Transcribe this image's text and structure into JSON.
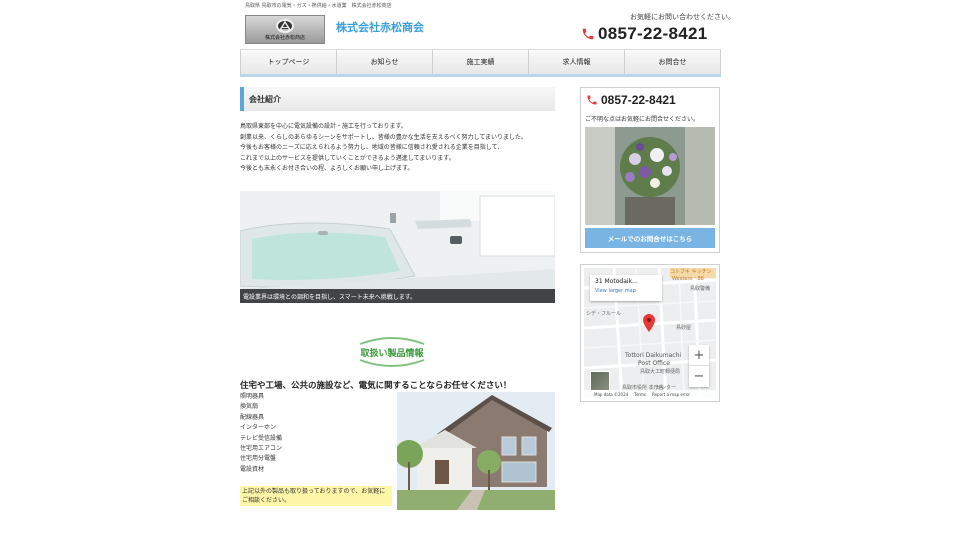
{
  "header": {
    "tagline": "鳥取県 鳥取市の電気・ガス・熱供給・水道業　株式会社赤松商店",
    "logo_text": "株式会社赤松商店",
    "company_name": "株式会社赤松商会",
    "contact_note": "お気軽にお問い合わせください。",
    "phone": "0857-22-8421"
  },
  "nav": {
    "items": [
      "トップページ",
      "お知らせ",
      "施工実績",
      "求人情報",
      "お問合せ"
    ]
  },
  "main": {
    "section_title": "会社紹介",
    "intro_lines": [
      "鳥取県東部を中心に電気設備の設計・施工を行っております。",
      "創業以来、くらしのあらゆるシーンをサポートし、皆様の豊かな生活を支えるべく努力してまいりました。",
      "今後もお客様のニーズに応えられるよう努力し、地域の皆様に信頼され愛される企業を目指して、",
      "これまで以上のサービスを提供していくことができるよう邁進してまいります。",
      "今後とも末永くお付き合いの程、よろしくお願い申し上げます。"
    ],
    "bath_caption": "電設業界は環境との調和を目指し、スマート未来へ挑戦します。",
    "products_badge": "取扱い製品情報",
    "products_title": "住宅や工場、公共の施設など、電気に関することならお任せください！",
    "products": [
      "照明器具",
      "換気扇",
      "配線器具",
      "インターホン",
      "テレビ受信設備",
      "住宅用エアコン",
      "住宅用分電盤",
      "電設資材"
    ],
    "products_note": "上記以外の製品も取り扱っておりますので、お気軽にご相談ください。"
  },
  "sidebar": {
    "phone": "0857-22-8421",
    "note": "ご不明な点はお気軽にお問合せください。",
    "mail_button": "メールでのお問合せはこちら"
  },
  "map": {
    "address": "31 Motodaik...",
    "larger_link": "View larger map",
    "labels": [
      "コトブキ キッチン",
      "Western・88",
      "鳥取警備",
      "シデ・フルール",
      "鳥砂屋",
      "Tottori Daikumachi",
      "Post Office",
      "鳥取大工町郵便局",
      "鳥取市役所 本庁舎",
      "センター"
    ],
    "footer": [
      "Map data ©2024",
      "Terms",
      "Report a map error"
    ],
    "zoom_in": "+",
    "zoom_out": "−"
  },
  "colors": {
    "accent_blue": "#3aa0d8",
    "nav_border": "#b9d7ee",
    "phone_icon": "#e33b3b",
    "badge_green": "#3a9a3a",
    "note_highlight": "#fff6a8"
  }
}
